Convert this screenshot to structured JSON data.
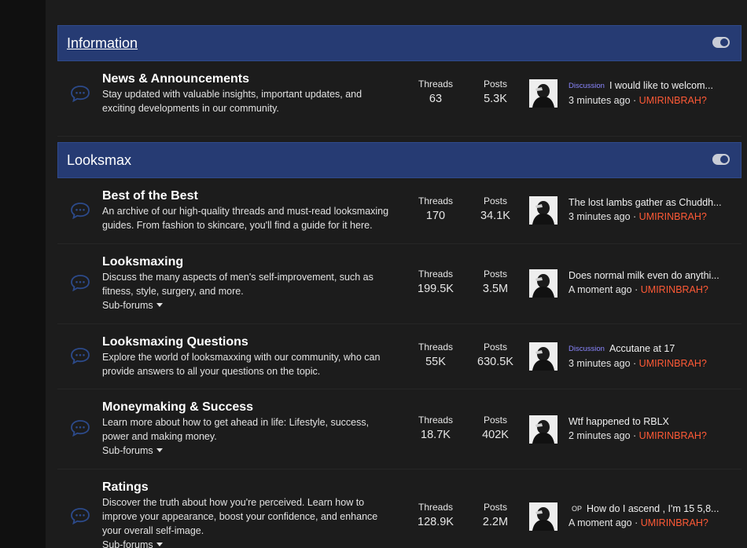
{
  "categories": [
    {
      "title": "Information",
      "forums": [
        {
          "title": "News & Announcements",
          "desc": [
            "Stay updated with valuable insights, important updates, and",
            "exciting developments in our community."
          ],
          "subforums": "",
          "threads_label": "Threads",
          "threads": "63",
          "posts_label": "Posts",
          "posts": "5.3K",
          "latest": {
            "prefix": "Discussion",
            "title": "I would like to welcom...",
            "time": "3 minutes ago",
            "sep": "·",
            "author": "UMIRINBRAH?"
          }
        }
      ]
    },
    {
      "title": "Looksmax",
      "forums": [
        {
          "title": "Best of the Best",
          "desc": [
            "An archive of our high-quality threads and must-read looksmaxing",
            "guides. From fashion to skincare, you'll find a guide for it here."
          ],
          "subforums": "",
          "threads_label": "Threads",
          "threads": "170",
          "posts_label": "Posts",
          "posts": "34.1K",
          "latest": {
            "prefix": "",
            "title": "The lost lambs gather as Chuddh...",
            "time": "3 minutes ago",
            "sep": "·",
            "author": "UMIRINBRAH?"
          }
        },
        {
          "title": "Looksmaxing",
          "desc": [
            "Discuss the many aspects of men's self-improvement, such as",
            "fitness, style, surgery, and more."
          ],
          "subforums": "Sub-forums",
          "threads_label": "Threads",
          "threads": "199.5K",
          "posts_label": "Posts",
          "posts": "3.5M",
          "latest": {
            "prefix": "",
            "title": "Does normal milk even do anythi...",
            "time": "A moment ago",
            "sep": "·",
            "author": "UMIRINBRAH?"
          }
        },
        {
          "title": "Looksmaxing Questions",
          "desc": [
            "Explore the world of looksmaxxing with our community, who can",
            "provide answers to all your questions on the topic."
          ],
          "subforums": "",
          "threads_label": "Threads",
          "threads": "55K",
          "posts_label": "Posts",
          "posts": "630.5K",
          "latest": {
            "prefix": "Discussion",
            "title": "Accutane at 17",
            "time": "3 minutes ago",
            "sep": "·",
            "author": "UMIRINBRAH?"
          }
        },
        {
          "title": "Moneymaking & Success",
          "desc": [
            "Learn more about how to get ahead in life: Lifestyle, success,",
            "power and making money."
          ],
          "subforums": "Sub-forums",
          "threads_label": "Threads",
          "threads": "18.7K",
          "posts_label": "Posts",
          "posts": "402K",
          "latest": {
            "prefix": "",
            "title": "Wtf happened to RBLX",
            "time": "2 minutes ago",
            "sep": "·",
            "author": "UMIRINBRAH?"
          }
        },
        {
          "title": "Ratings",
          "desc": [
            "Discover the truth about how you're perceived. Learn how to",
            "improve your appearance, boost your confidence, and enhance",
            "your overall self-image."
          ],
          "subforums": "Sub-forums",
          "threads_label": "Threads",
          "threads": "128.9K",
          "posts_label": "Posts",
          "posts": "2.2M",
          "latest": {
            "prefix": "OP",
            "title": "How do I ascend , I'm 15 5,8...",
            "time": "A moment ago",
            "sep": "·",
            "author": "UMIRINBRAH?"
          }
        }
      ]
    }
  ],
  "colors": {
    "header_bg": "#263b73",
    "author": "#ff5a36",
    "prefix": "#8a86ff",
    "icon": "#2c4a8a"
  },
  "icons": {
    "forum": "chat-bubble-icon",
    "toggle": "collapse-toggle-icon"
  }
}
